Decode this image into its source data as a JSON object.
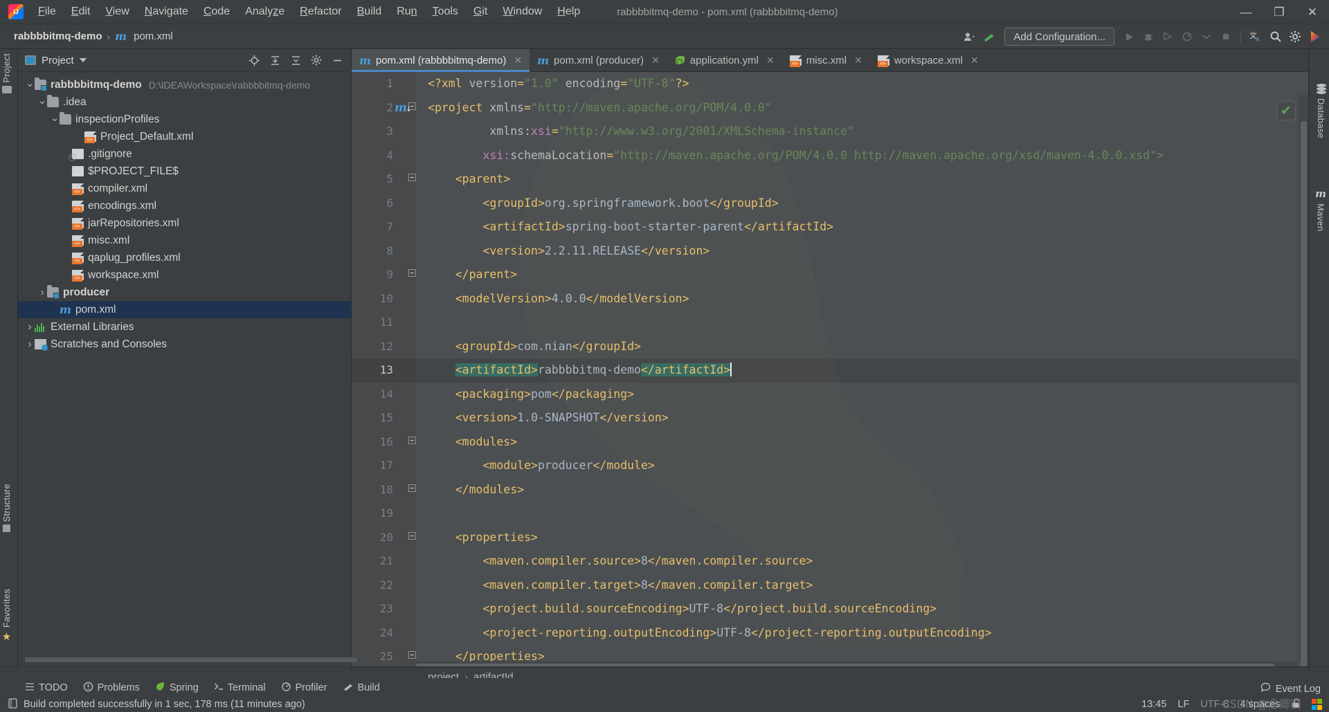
{
  "window": {
    "title": "rabbbbitmq-demo - pom.xml (rabbbbitmq-demo)",
    "minimize": "—",
    "maximize": "❐",
    "close": "✕"
  },
  "menu": [
    {
      "label": "File",
      "mnemonic": "F"
    },
    {
      "label": "Edit",
      "mnemonic": "E"
    },
    {
      "label": "View",
      "mnemonic": "V"
    },
    {
      "label": "Navigate",
      "mnemonic": "N"
    },
    {
      "label": "Code",
      "mnemonic": "C"
    },
    {
      "label": "Analyze",
      "mnemonic": "z"
    },
    {
      "label": "Refactor",
      "mnemonic": "R"
    },
    {
      "label": "Build",
      "mnemonic": "B"
    },
    {
      "label": "Run",
      "mnemonic": "n"
    },
    {
      "label": "Tools",
      "mnemonic": "T"
    },
    {
      "label": "Git",
      "mnemonic": "G"
    },
    {
      "label": "Window",
      "mnemonic": "W"
    },
    {
      "label": "Help",
      "mnemonic": "H"
    }
  ],
  "navbar": {
    "project": "rabbbbitmq-demo",
    "separator": "›",
    "file": "pom.xml",
    "file_icon": "maven-m-icon",
    "add_configuration": "Add Configuration...",
    "icons": {
      "user": "user-dropdown-icon",
      "hammer": "build-hammer-icon",
      "run": "run-icon",
      "debug": "debug-icon",
      "coverage": "run-with-coverage-icon",
      "profile": "profile-icon",
      "dropdown": "chevron-down-icon",
      "stop": "stop-icon",
      "translate": "translate-icon",
      "search": "search-everywhere-icon",
      "settings": "gear-icon",
      "updates": "plugin-updates-icon"
    }
  },
  "left_stripe": [
    {
      "label": "Project",
      "name": "tool-window-project"
    },
    {
      "label": "Structure",
      "name": "tool-window-structure"
    },
    {
      "label": "Favorites",
      "name": "tool-window-favorites"
    }
  ],
  "right_stripe": [
    {
      "label": "Database",
      "name": "tool-window-database"
    },
    {
      "label": "Maven",
      "name": "tool-window-maven"
    }
  ],
  "project_panel": {
    "title": "Project",
    "tools": [
      "locate-icon",
      "collapse-all-icon",
      "expand-icon",
      "gear-icon",
      "hide-icon"
    ],
    "tree": [
      {
        "label": "rabbbbitmq-demo",
        "path": "D:\\IDEAWorkspace\\rabbbbitmq-demo",
        "indent": 0,
        "twist": "down",
        "icon": "module-folder",
        "bold": true,
        "selected": false
      },
      {
        "label": ".idea",
        "path": "",
        "indent": 1,
        "twist": "down",
        "icon": "folder",
        "bold": false,
        "selected": false
      },
      {
        "label": "inspectionProfiles",
        "path": "",
        "indent": 2,
        "twist": "down",
        "icon": "folder",
        "bold": false,
        "selected": false
      },
      {
        "label": "Project_Default.xml",
        "path": "",
        "indent": 4,
        "twist": "none",
        "icon": "xml",
        "bold": false,
        "selected": false
      },
      {
        "label": ".gitignore",
        "path": "",
        "indent": 3,
        "twist": "none",
        "icon": "gitignore",
        "bold": false,
        "selected": false
      },
      {
        "label": "$PROJECT_FILE$",
        "path": "",
        "indent": 3,
        "twist": "none",
        "icon": "plain",
        "bold": false,
        "selected": false
      },
      {
        "label": "compiler.xml",
        "path": "",
        "indent": 3,
        "twist": "none",
        "icon": "xml",
        "bold": false,
        "selected": false
      },
      {
        "label": "encodings.xml",
        "path": "",
        "indent": 3,
        "twist": "none",
        "icon": "xml",
        "bold": false,
        "selected": false
      },
      {
        "label": "jarRepositories.xml",
        "path": "",
        "indent": 3,
        "twist": "none",
        "icon": "xml",
        "bold": false,
        "selected": false
      },
      {
        "label": "misc.xml",
        "path": "",
        "indent": 3,
        "twist": "none",
        "icon": "xml",
        "bold": false,
        "selected": false
      },
      {
        "label": "qaplug_profiles.xml",
        "path": "",
        "indent": 3,
        "twist": "none",
        "icon": "xml",
        "bold": false,
        "selected": false
      },
      {
        "label": "workspace.xml",
        "path": "",
        "indent": 3,
        "twist": "none",
        "icon": "xml",
        "bold": false,
        "selected": false
      },
      {
        "label": "producer",
        "path": "",
        "indent": 1,
        "twist": "right",
        "icon": "module-folder",
        "bold": true,
        "selected": false
      },
      {
        "label": "pom.xml",
        "path": "",
        "indent": 2,
        "twist": "none",
        "icon": "maven",
        "bold": false,
        "selected": true
      },
      {
        "label": "External Libraries",
        "path": "",
        "indent": 0,
        "twist": "right",
        "icon": "library",
        "bold": false,
        "selected": false
      },
      {
        "label": "Scratches and Consoles",
        "path": "",
        "indent": 0,
        "twist": "right",
        "icon": "scratch",
        "bold": false,
        "selected": false
      }
    ]
  },
  "editor_tabs": [
    {
      "label": "pom.xml (rabbbbitmq-demo)",
      "icon": "maven",
      "active": true,
      "close": "✕"
    },
    {
      "label": "pom.xml (producer)",
      "icon": "maven",
      "active": false,
      "close": "✕"
    },
    {
      "label": "application.yml",
      "icon": "spring",
      "active": false,
      "close": "✕"
    },
    {
      "label": "misc.xml",
      "icon": "xml",
      "active": false,
      "close": "✕"
    },
    {
      "label": "workspace.xml",
      "icon": "xml",
      "active": false,
      "close": "✕"
    }
  ],
  "editor": {
    "current_line": 13,
    "caret_column": 37,
    "lines": [
      {
        "n": 1,
        "fold": "",
        "indent": 0,
        "parts": [
          {
            "t": "punc",
            "s": "<?"
          },
          {
            "t": "kw",
            "s": "xml"
          },
          {
            "t": "attr",
            "s": " version"
          },
          {
            "t": "punc",
            "s": "="
          },
          {
            "t": "str",
            "s": "\"1.0\""
          },
          {
            "t": "attr",
            "s": " encoding"
          },
          {
            "t": "punc",
            "s": "="
          },
          {
            "t": "str",
            "s": "\"UTF-8\""
          },
          {
            "t": "punc",
            "s": "?>"
          }
        ]
      },
      {
        "n": 2,
        "fold": "-",
        "indent": 0,
        "parts": [
          {
            "t": "punc",
            "s": "<"
          },
          {
            "t": "kw",
            "s": "project"
          },
          {
            "t": "attr",
            "s": " xmlns"
          },
          {
            "t": "punc",
            "s": "="
          },
          {
            "t": "str",
            "s": "\"http://maven.apache.org/POM/4.0.0\""
          }
        ]
      },
      {
        "n": 3,
        "fold": "",
        "indent": 9,
        "parts": [
          {
            "t": "attr",
            "s": "xmlns:"
          },
          {
            "t": "ns",
            "s": "xsi"
          },
          {
            "t": "punc",
            "s": "="
          },
          {
            "t": "str",
            "s": "\"http://www.w3.org/2001/XMLSchema-instance\""
          }
        ]
      },
      {
        "n": 4,
        "fold": "",
        "indent": 8,
        "parts": [
          {
            "t": "ns",
            "s": "xsi:"
          },
          {
            "t": "attr",
            "s": "schemaLocation"
          },
          {
            "t": "punc",
            "s": "="
          },
          {
            "t": "str",
            "s": "\"http://maven.apache.org/POM/4.0.0 http://maven.apache.org/xsd/maven-4.0.0.xsd\">"
          }
        ]
      },
      {
        "n": 5,
        "fold": "-",
        "indent": 4,
        "parts": [
          {
            "t": "kw",
            "s": "<parent>"
          }
        ]
      },
      {
        "n": 6,
        "fold": "",
        "indent": 8,
        "parts": [
          {
            "t": "kw",
            "s": "<groupId>"
          },
          {
            "t": "txt",
            "s": "org.springframework.boot"
          },
          {
            "t": "kw",
            "s": "</groupId>"
          }
        ]
      },
      {
        "n": 7,
        "fold": "",
        "indent": 8,
        "parts": [
          {
            "t": "kw",
            "s": "<artifactId>"
          },
          {
            "t": "txt",
            "s": "spring-boot-starter-parent"
          },
          {
            "t": "kw",
            "s": "</artifactId>"
          }
        ]
      },
      {
        "n": 8,
        "fold": "",
        "indent": 8,
        "parts": [
          {
            "t": "kw",
            "s": "<version>"
          },
          {
            "t": "txt",
            "s": "2.2.11.RELEASE"
          },
          {
            "t": "kw",
            "s": "</version>"
          }
        ]
      },
      {
        "n": 9,
        "fold": "-",
        "indent": 4,
        "parts": [
          {
            "t": "kw",
            "s": "</parent>"
          }
        ]
      },
      {
        "n": 10,
        "fold": "",
        "indent": 4,
        "parts": [
          {
            "t": "kw",
            "s": "<modelVersion>"
          },
          {
            "t": "txt",
            "s": "4.0.0"
          },
          {
            "t": "kw",
            "s": "</modelVersion>"
          }
        ]
      },
      {
        "n": 11,
        "fold": "",
        "indent": 0,
        "parts": []
      },
      {
        "n": 12,
        "fold": "",
        "indent": 4,
        "parts": [
          {
            "t": "kw",
            "s": "<groupId>"
          },
          {
            "t": "txt",
            "s": "com.nian"
          },
          {
            "t": "kw",
            "s": "</groupId>"
          }
        ]
      },
      {
        "n": 13,
        "fold": "",
        "indent": 4,
        "parts": [
          {
            "t": "kw hl",
            "s": "<artifactId>"
          },
          {
            "t": "txt",
            "s": "rabbbbitmq-demo"
          },
          {
            "t": "kw hl",
            "s": "</artifactId>"
          },
          {
            "t": "caret",
            "s": ""
          }
        ]
      },
      {
        "n": 14,
        "fold": "",
        "indent": 4,
        "parts": [
          {
            "t": "kw",
            "s": "<packaging>"
          },
          {
            "t": "txt",
            "s": "pom"
          },
          {
            "t": "kw",
            "s": "</packaging>"
          }
        ]
      },
      {
        "n": 15,
        "fold": "",
        "indent": 4,
        "parts": [
          {
            "t": "kw",
            "s": "<version>"
          },
          {
            "t": "txt",
            "s": "1.0-SNAPSHOT"
          },
          {
            "t": "kw",
            "s": "</version>"
          }
        ]
      },
      {
        "n": 16,
        "fold": "-",
        "indent": 4,
        "parts": [
          {
            "t": "kw",
            "s": "<modules>"
          }
        ]
      },
      {
        "n": 17,
        "fold": "",
        "indent": 8,
        "parts": [
          {
            "t": "kw",
            "s": "<module>"
          },
          {
            "t": "txt",
            "s": "producer"
          },
          {
            "t": "kw",
            "s": "</module>"
          }
        ]
      },
      {
        "n": 18,
        "fold": "-",
        "indent": 4,
        "parts": [
          {
            "t": "kw",
            "s": "</modules>"
          }
        ]
      },
      {
        "n": 19,
        "fold": "",
        "indent": 0,
        "parts": []
      },
      {
        "n": 20,
        "fold": "-",
        "indent": 4,
        "parts": [
          {
            "t": "kw",
            "s": "<properties>"
          }
        ]
      },
      {
        "n": 21,
        "fold": "",
        "indent": 8,
        "parts": [
          {
            "t": "kw",
            "s": "<maven.compiler.source>"
          },
          {
            "t": "txt",
            "s": "8"
          },
          {
            "t": "kw",
            "s": "</maven.compiler.source>"
          }
        ]
      },
      {
        "n": 22,
        "fold": "",
        "indent": 8,
        "parts": [
          {
            "t": "kw",
            "s": "<maven.compiler.target>"
          },
          {
            "t": "txt",
            "s": "8"
          },
          {
            "t": "kw",
            "s": "</maven.compiler.target>"
          }
        ]
      },
      {
        "n": 23,
        "fold": "",
        "indent": 8,
        "parts": [
          {
            "t": "kw",
            "s": "<project.build.sourceEncoding>"
          },
          {
            "t": "txt",
            "s": "UTF-8"
          },
          {
            "t": "kw",
            "s": "</project.build.sourceEncoding>"
          }
        ]
      },
      {
        "n": 24,
        "fold": "",
        "indent": 8,
        "parts": [
          {
            "t": "kw",
            "s": "<project-reporting.outputEncoding>"
          },
          {
            "t": "txt",
            "s": "UTF-8"
          },
          {
            "t": "kw",
            "s": "</project-reporting.outputEncoding>"
          }
        ]
      },
      {
        "n": 25,
        "fold": "-",
        "indent": 4,
        "parts": [
          {
            "t": "kw",
            "s": "</properties>"
          }
        ]
      }
    ]
  },
  "editor_breadcrumb": [
    {
      "label": "project"
    },
    {
      "label": "›"
    },
    {
      "label": "artifactId"
    }
  ],
  "bottom_tools": [
    {
      "label": "TODO",
      "icon": "todo-icon"
    },
    {
      "label": "Problems",
      "icon": "problems-icon"
    },
    {
      "label": "Spring",
      "icon": "spring-icon"
    },
    {
      "label": "Terminal",
      "icon": "terminal-icon"
    },
    {
      "label": "Profiler",
      "icon": "profiler-icon"
    },
    {
      "label": "Build",
      "icon": "build-icon"
    }
  ],
  "status": {
    "message": "Build completed successfully in 1 sec, 178 ms (11 minutes ago)",
    "message_icon": "build-log-icon",
    "event_log": "Event Log",
    "event_log_icon": "event-log-icon",
    "time": "13:45",
    "line_sep": "LF",
    "encoding": "UTF-8",
    "indent": "4 spaces",
    "lock_icon": "unlocked-icon",
    "watermark": "CSDN @念卿旧"
  },
  "colors": {
    "accent_blue": "#4a88c7",
    "selection": "#1f3350",
    "tag": "#e8bf6a",
    "string": "#6a8759",
    "text": "#a9b7c6",
    "ns": "#c77dbb",
    "highlight": "#386c63",
    "bg_editor": "#4b4f51",
    "bg_panel": "#3c3f41"
  }
}
